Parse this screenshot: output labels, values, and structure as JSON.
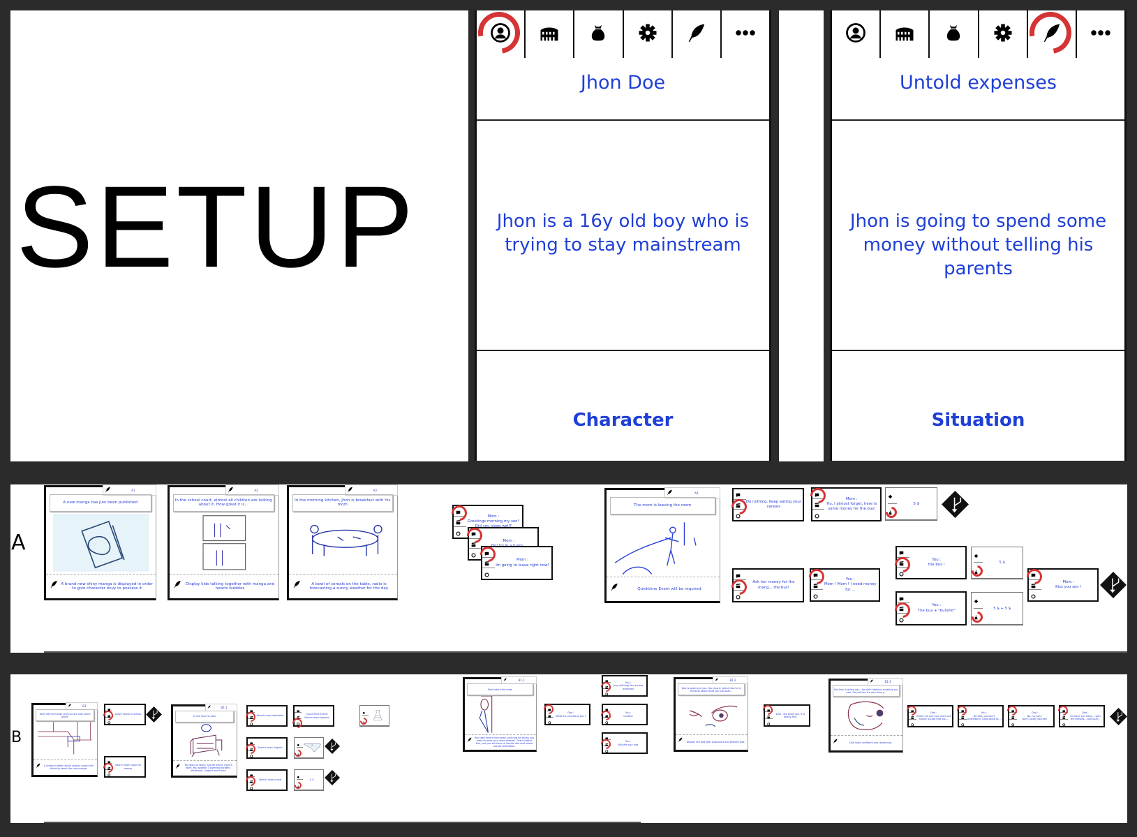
{
  "setup": {
    "title": "SETUP"
  },
  "top_cards": [
    {
      "icons": [
        "character-icon",
        "location-icon",
        "money-bag-icon",
        "gear-icon",
        "quill-icon",
        "more-icon"
      ],
      "active_icon": "character-icon",
      "title": "Jhon Doe",
      "body": "Jhon is a 16y old boy who is trying to stay mainstream",
      "label": "Character"
    },
    {
      "icons": [
        "character-icon",
        "location-icon",
        "money-bag-icon",
        "gear-icon",
        "quill-icon",
        "more-icon"
      ],
      "active_icon": "quill-icon",
      "title": "Untold expenses",
      "body": "Jhon is going to spend some money without telling his parents",
      "label": "Situation"
    }
  ],
  "rows": [
    {
      "label": "A"
    },
    {
      "label": "B"
    }
  ],
  "colors": {
    "text_blue": "#2a3fd4",
    "title_blue": "#1f3fd6",
    "highlight_red": "#d43434",
    "background": "#2b2b2b"
  },
  "scenes": [
    {
      "id": "A1",
      "caption": "A new manga has just been published",
      "note": "A brand new shiny manga is displayed in order to give character envy to possess it",
      "image": "manga-sketch"
    },
    {
      "id": "A2",
      "caption": "In the school court, almost all children are talking about it. How great it is...",
      "note": "Display kids talking together with manga and hearts bubbles",
      "image": "kids-sketch"
    },
    {
      "id": "A3",
      "caption": "In the morning kitchen, Jhon is breakfast with his mom",
      "note": "A bowl of cereals on the table, radio is forecasting a sunny weather for the day",
      "image": "kitchen-table-sketch"
    },
    {
      "id": "A4",
      "caption": "The mom is leaving the room",
      "note": "Quicktime Event will be required",
      "image": "mom-leaving-sketch"
    },
    {
      "id": "B1",
      "caption": "Mom left the house and you are now home alone.",
      "note": "A dream bubble should display player still thinking about the new manga.",
      "image": "house-sketch"
    },
    {
      "id": "B1.1",
      "caption": "In the mom's room",
      "note": "You step up stairs, and arrived in mom's room. You spotted 3 potential targets : Wardrobe, Lingerie and Purse",
      "image": "dresser-sketch"
    },
    {
      "id": "B1.1",
      "caption": "Dad enters the room",
      "note": "Your dad enters the rooms, and now he thinks you want to wear your mom dresses. That's totally fine, but you will have to handle dad chat about sexual orientation.",
      "image": "dad-door-sketch"
    },
    {
      "id": "B1.2",
      "caption": "Dad is looking at you. You clearly notice that he is thinking about what you just said...",
      "note": "Display the dad with suspicious and perplex look",
      "image": "suspicious-eyes-sketch"
    },
    {
      "id": "B1.3",
      "caption": "His face is telling you : He didn't believe anything you said. He just has it's own theory...",
      "note": "Dad looks confident and reassuring",
      "image": "winking-face-sketch"
    }
  ],
  "dialogs": [
    {
      "text": "Mom :\nGreetings morning my son! Did you sleep well?",
      "highlight": "speech"
    },
    {
      "text": "Mom :\nHo! Im in a hurry...",
      "highlight": "speech"
    },
    {
      "text": "Mom :\nIm going to leave right now!",
      "highlight": "speech"
    },
    {
      "text": "Do nothing. Keep eating your cereals",
      "highlight": "action"
    },
    {
      "text": "Ask her money for the mang... the bus!",
      "highlight": "action"
    },
    {
      "text": "Mom :\nHo, I almost forget, here is some money for the bus!",
      "highlight": "speech"
    },
    {
      "text": "You :\nMom ! Mom ! I need money for ...",
      "highlight": "speech"
    },
    {
      "text": "You :\nthe bus !",
      "highlight": "action"
    },
    {
      "text": "You :\nThe bus + \"bullshit\"",
      "highlight": "action"
    },
    {
      "text": "Mom :\nKiss you son !",
      "highlight": "speech"
    },
    {
      "text": "Leave house to school",
      "highlight": "action"
    },
    {
      "text": "Search mom room for money",
      "highlight": "action"
    },
    {
      "text": "Search mom wardrobe",
      "highlight": "action"
    },
    {
      "text": "(QuickTime Event)\nSearch mom dresses",
      "highlight": "gear"
    },
    {
      "text": "Search mom lingerie",
      "highlight": "action"
    },
    {
      "text": "Search mom purse",
      "highlight": "action"
    },
    {
      "text": "Dad :\nWhat are you doing son ?",
      "highlight": "speech"
    },
    {
      "text": "You :\n(say nothing) You are too ashamed",
      "highlight": "action"
    },
    {
      "text": "You :\nConfess",
      "highlight": "action"
    },
    {
      "text": "You :\nBullshit your dad",
      "highlight": "action"
    },
    {
      "text": "Dad : You know son, it is totally fine.",
      "highlight": "speech"
    },
    {
      "text": "Dad :\nEither me and your mom will totally accept that you...",
      "highlight": "speech"
    },
    {
      "text": "You :\nNo dad, you don't understand, I was going to....",
      "highlight": "speech"
    },
    {
      "text": "Dad :\nNo, no, son !\nDon't justify yourself.",
      "highlight": "speech"
    },
    {
      "text": "Dad :\nI'll leave you alone... with the dresses... and stuff...",
      "highlight": "speech"
    }
  ],
  "conditions": [
    {
      "text": "5 $"
    },
    {
      "text": "5 $"
    },
    {
      "text": "5 $ + 5 $"
    },
    {
      "image": "dress-sketch"
    },
    {
      "image": "panties-sketch"
    },
    {
      "text": "5 $"
    }
  ]
}
